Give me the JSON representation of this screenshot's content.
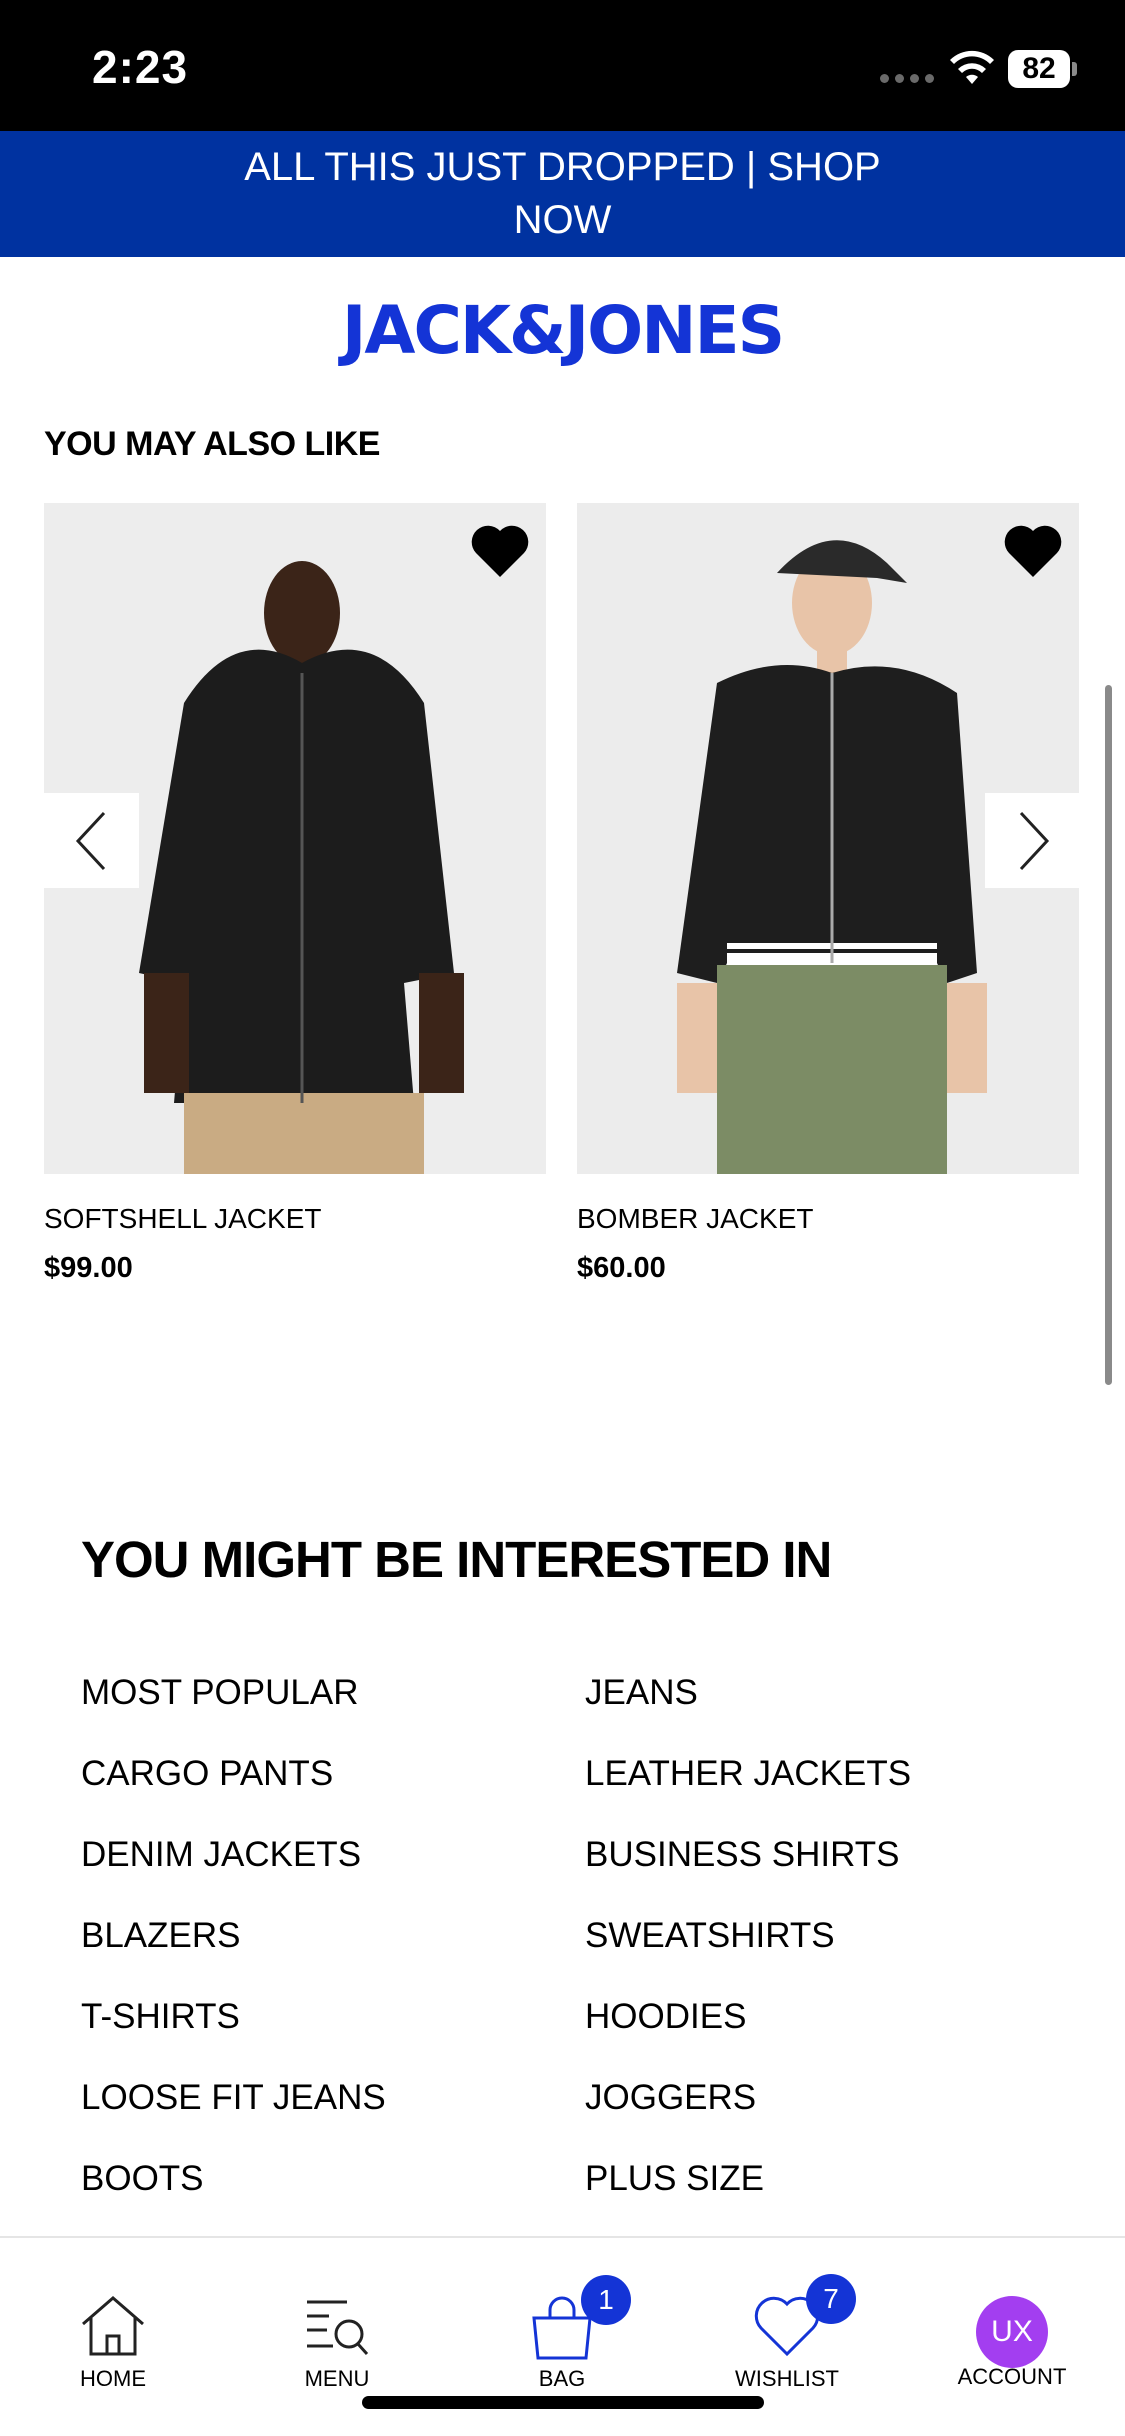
{
  "status_bar": {
    "time": "2:23",
    "battery": "82"
  },
  "promo": {
    "text": "ALL THIS JUST DROPPED | SHOP NOW"
  },
  "brand": {
    "logo": "JACK&JONES",
    "accent": "#1434d6",
    "promo_bg": "#0032a0"
  },
  "recommendations": {
    "title": "YOU MAY ALSO LIKE",
    "products": [
      {
        "name": "SOFTSHELL JACKET",
        "price": "$99.00"
      },
      {
        "name": "BOMBER JACKET",
        "price": "$60.00"
      }
    ]
  },
  "interests": {
    "title": "YOU MIGHT BE INTERESTED IN",
    "links": [
      "MOST POPULAR",
      "JEANS",
      "CARGO PANTS",
      "LEATHER JACKETS",
      "DENIM JACKETS",
      "BUSINESS SHIRTS",
      "BLAZERS",
      "SWEATSHIRTS",
      "T-SHIRTS",
      "HOODIES",
      "LOOSE FIT JEANS",
      "JOGGERS",
      "BOOTS",
      "PLUS SIZE"
    ]
  },
  "nav": {
    "home": "HOME",
    "menu": "MENU",
    "bag": "BAG",
    "bag_count": "1",
    "wishlist": "WISHLIST",
    "wishlist_count": "7",
    "account": "ACCOUNT",
    "avatar_initials": "UX"
  }
}
